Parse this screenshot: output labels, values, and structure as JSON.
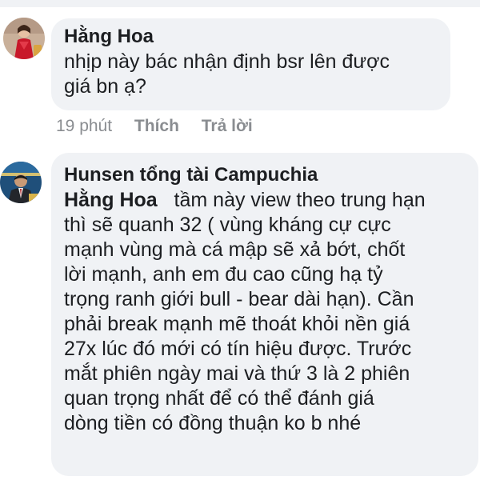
{
  "comments": [
    {
      "author": "Hằng Hoa",
      "text_lines": [
        "nhịp này bác nhận định bsr lên được",
        "giá bn ạ?"
      ],
      "time": "19 phút",
      "like_label": "Thích",
      "reply_label": "Trả lời",
      "avatar_icon": "user-avatar-red-dress"
    },
    {
      "author": "Hunsen tổng tài Campuchia",
      "mention": "Hằng Hoa",
      "text_first_line_rest": "tầm này view theo trung hạn",
      "text_lines": [
        "thì sẽ quanh 32 ( vùng kháng cự cực",
        "mạnh vùng mà cá mập sẽ xả bớt, chốt",
        "lời mạnh, anh em đu cao cũng hạ tỷ",
        "trọng ranh giới bull - bear dài hạn). Cần",
        "phải break mạnh mẽ thoát khỏi nền giá",
        "27x lúc đó mới có tín hiệu được. Trước",
        "mắt phiên ngày mai và thứ 3 là 2 phiên",
        "quan trọng nhất để có thể đánh giá",
        "dòng tiền có đồng thuận ko b nhé"
      ],
      "avatar_icon": "user-avatar-man-suit"
    }
  ],
  "colors": {
    "bubble": "#f0f2f5",
    "text": "#1c1e21",
    "meta": "#8a8d91"
  }
}
